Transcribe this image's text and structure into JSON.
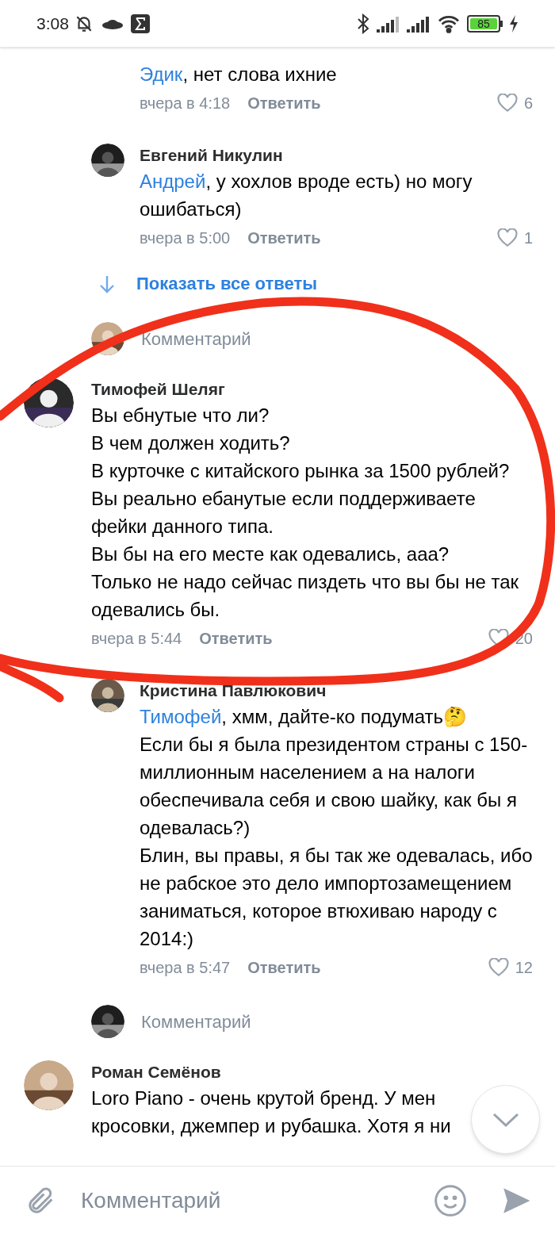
{
  "status_bar": {
    "time": "3:08",
    "battery": "85"
  },
  "feed": [
    {
      "kind": "reply",
      "avatar": false,
      "mention": "Эдик",
      "text": ", нет слова ихние",
      "time": "вчера в 4:18",
      "reply": "Ответить",
      "likes": "6"
    },
    {
      "kind": "reply",
      "avatar": true,
      "name": "Евгений Никулин",
      "mention": "Андрей",
      "text": ", у хохлов вроде есть) но могу ошибаться)",
      "time": "вчера в 5:00",
      "reply": "Ответить",
      "likes": "1"
    },
    {
      "kind": "show_more",
      "label": "Показать все ответы"
    },
    {
      "kind": "composer",
      "placeholder": "Комментарий"
    },
    {
      "kind": "comment",
      "avatar": true,
      "name": "Тимофей Шеляг",
      "text": "Вы ебнутые что ли?\nВ чем должен ходить?\nВ курточке с китайского рынка за 1500 рублей?\nВы реально ебанутые если поддерживаете фейки данного типа.\nВы бы на его месте как одевались, ааа?\nТолько не надо сейчас пиздеть что вы бы не так одевались бы.",
      "time": "вчера в 5:44",
      "reply": "Ответить",
      "likes": "20"
    },
    {
      "kind": "reply",
      "avatar": true,
      "name": "Кристина Павлюкович",
      "mention": "Тимофей",
      "text": ", хмм, дайте-ко подумать🤔\nЕсли бы я была президентом страны с 150-миллионным населением а на налоги обеспечивала себя и свою шайку, как бы я одевалась?)\nБлин, вы правы, я бы так же одевалась, ибо не рабское это дело импортозамещением заниматься, которое втюхиваю народу с 2014:)",
      "time": "вчера в 5:47",
      "reply": "Ответить",
      "likes": "12"
    },
    {
      "kind": "composer",
      "placeholder": "Комментарий"
    },
    {
      "kind": "comment",
      "avatar": true,
      "name": "Роман Семёнов",
      "text": "Loro Piano - очень крутой бренд. У мен\nкросовки, джемпер и рубашка. Хотя я ни"
    }
  ],
  "composer": {
    "placeholder": "Комментарий"
  }
}
